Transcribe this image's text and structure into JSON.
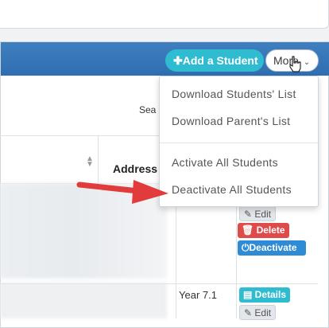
{
  "toolbar": {
    "add_student_label": "✚Add a Student",
    "more_label": "More"
  },
  "search": {
    "label": "Sea"
  },
  "table": {
    "address_header": "Address",
    "rows": [
      {
        "class": "",
        "actions": {
          "edit": "Edit",
          "delete": "Delete",
          "deactivate": "Deactivate"
        }
      },
      {
        "class": "Year 7.1",
        "actions": {
          "details": "Details",
          "edit": "Edit"
        }
      }
    ]
  },
  "dropdown": {
    "items": [
      "Download Students' List",
      "Download Parent's List",
      "Activate All Students",
      "Deactivate All Students"
    ]
  },
  "colors": {
    "header_bar": "#3576b8",
    "add_button": "#2fbcd0",
    "delete_button": "#df4b4b",
    "deactivate_button": "#2e8bd4",
    "annotation_arrow": "#e23b3b"
  }
}
